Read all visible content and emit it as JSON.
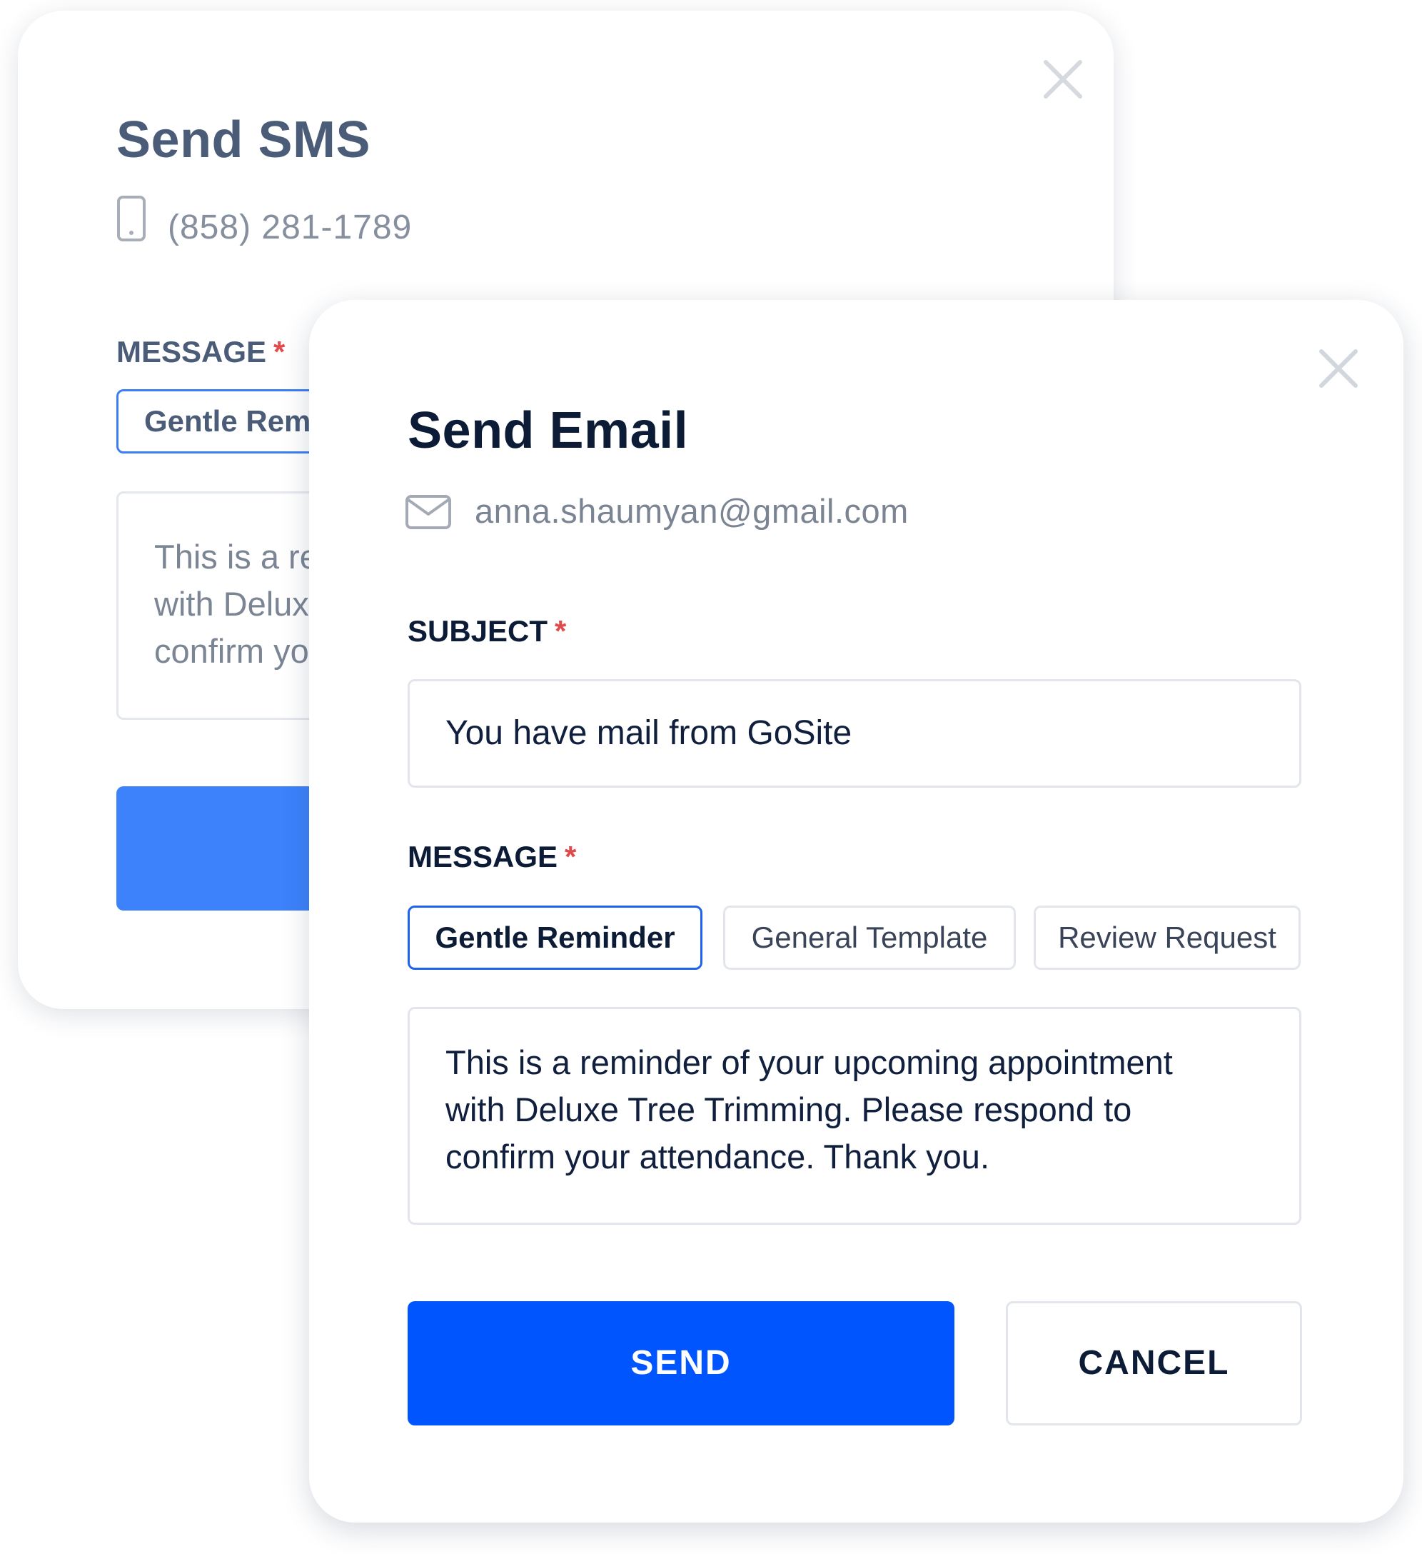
{
  "sms_dialog": {
    "title": "Send SMS",
    "phone": "(858) 281-1789",
    "message_label": "MESSAGE",
    "required_marker": "*",
    "selected_template": "Gentle Rem",
    "message_lines": [
      "This is a re",
      "with Delux",
      "confirm yo"
    ],
    "send_button_color": "#3d82fb"
  },
  "email_dialog": {
    "title": "Send Email",
    "email": "anna.shaumyan@gmail.com",
    "subject_label": "SUBJECT",
    "subject_value": "You have mail from GoSite",
    "message_label": "MESSAGE",
    "required_marker": "*",
    "templates": [
      {
        "label": "Gentle Reminder",
        "selected": true
      },
      {
        "label": "General Template",
        "selected": false
      },
      {
        "label": "Review Request",
        "selected": false
      }
    ],
    "message_lines": [
      "This is a reminder of your upcoming appointment",
      "with Deluxe Tree Trimming. Please respond to",
      "confirm your attendance. Thank you."
    ],
    "send_label": "SEND",
    "cancel_label": "CANCEL"
  },
  "colors": {
    "primary": "#0055ff",
    "required": "#e04a4a",
    "heading": "#0c1b36",
    "border": "#e2e6ec"
  },
  "icons": {
    "close": "close-icon",
    "phone": "phone-icon",
    "mail": "mail-icon"
  }
}
